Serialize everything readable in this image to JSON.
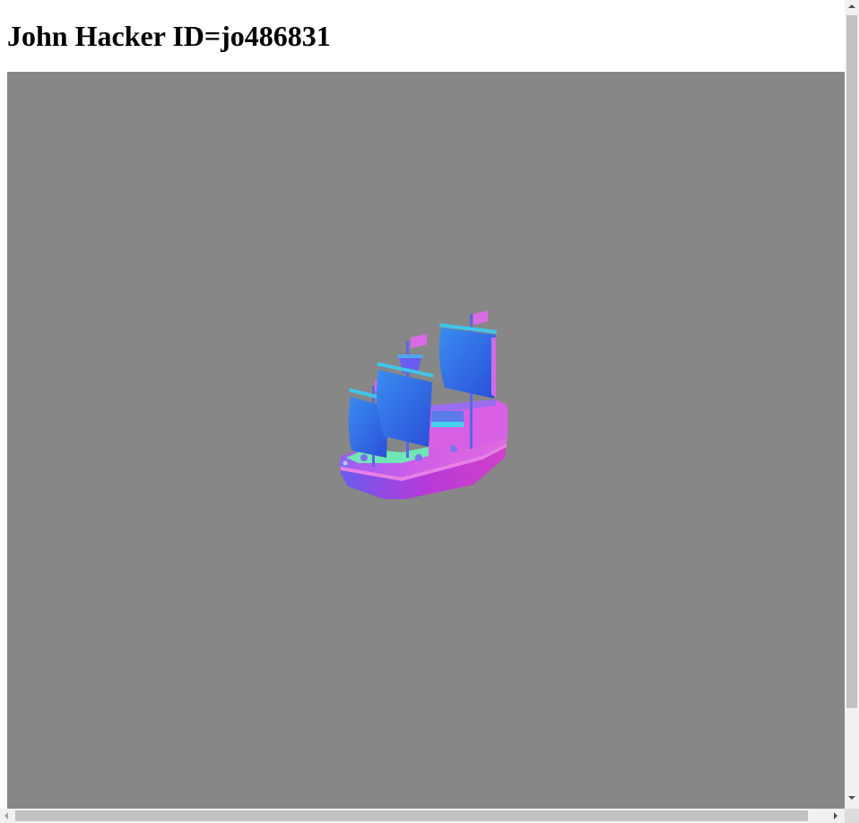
{
  "page": {
    "heading": "John Hacker ID=jo486831"
  },
  "viewport": {
    "background_color": "#878787",
    "model": "pirate-ship-icon",
    "model_colors": {
      "sail": "#2f6fe0",
      "hull": "#d85fe6",
      "deck": "#6fe9b0",
      "keel": "#b33ae8"
    }
  }
}
